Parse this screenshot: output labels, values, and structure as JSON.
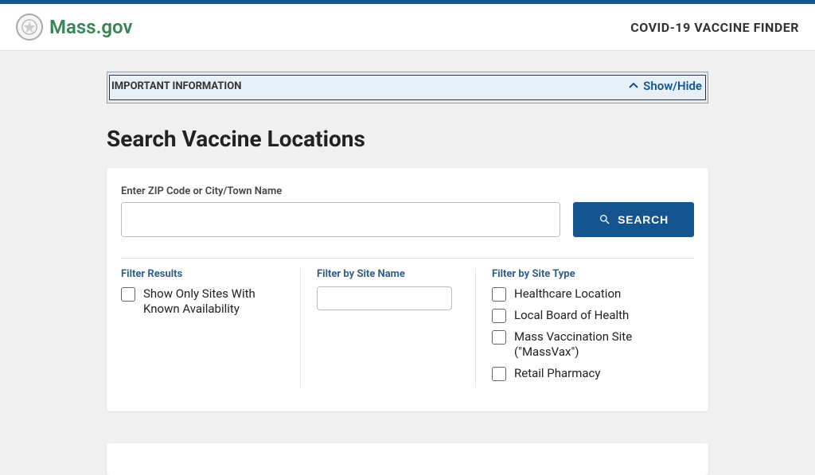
{
  "header": {
    "site_name": "Mass.gov",
    "right_text": "COVID-19 VACCINE FINDER"
  },
  "banner": {
    "label": "IMPORTANT INFORMATION",
    "toggle": "Show/Hide"
  },
  "page_title": "Search Vaccine Locations",
  "search": {
    "label": "Enter ZIP Code or City/Town Name",
    "value": "",
    "button_label": "SEARCH"
  },
  "filters": {
    "results_heading": "Filter Results",
    "availability_label": "Show Only Sites With Known Availability",
    "site_name_heading": "Filter by Site Name",
    "site_name_value": "",
    "site_type_heading": "Filter by Site Type",
    "site_types": [
      "Healthcare Location",
      "Local Board of Health",
      "Mass Vaccination Site (\"MassVax\")",
      "Retail Pharmacy"
    ]
  }
}
